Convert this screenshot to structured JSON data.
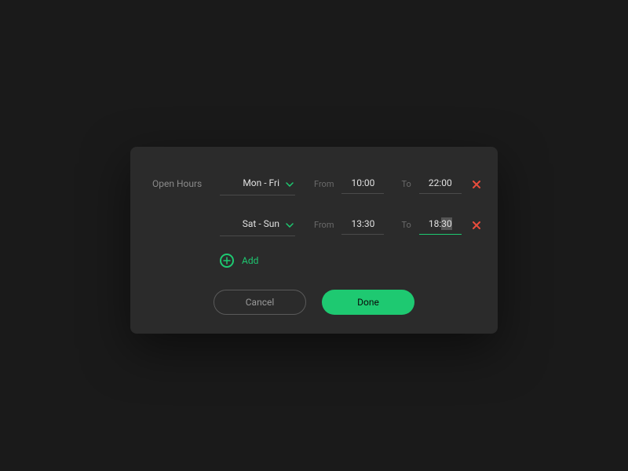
{
  "colors": {
    "accent": "#1ec971",
    "danger": "#e74c3c"
  },
  "dialog": {
    "section_label": "Open Hours",
    "from_label": "From",
    "to_label": "To",
    "add_label": "Add",
    "cancel_label": "Cancel",
    "done_label": "Done"
  },
  "rows": [
    {
      "days": "Mon - Fri",
      "from": "10:00",
      "to": "22:00",
      "to_hour": "22",
      "to_min": "00",
      "editing": false
    },
    {
      "days": "Sat - Sun",
      "from": "13:30",
      "to": "18:30",
      "to_hour": "18:",
      "to_min": "30",
      "editing": true
    }
  ]
}
